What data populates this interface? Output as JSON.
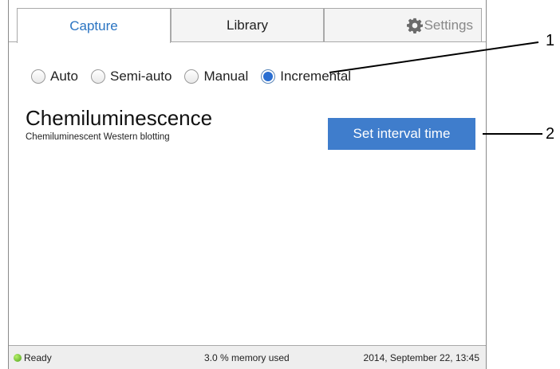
{
  "tabs": [
    {
      "label": "Capture"
    },
    {
      "label": "Library"
    },
    {
      "label": "Settings",
      "icon": "gear-icon"
    }
  ],
  "capture_modes": {
    "options": [
      "Auto",
      "Semi-auto",
      "Manual",
      "Incremental"
    ],
    "selected": "Incremental"
  },
  "application": {
    "title": "Chemiluminescence",
    "subtitle": "Chemiluminescent Western blotting"
  },
  "interval_button": {
    "label": "Set interval time"
  },
  "status_bar": {
    "state": "Ready",
    "memory": "3.0 % memory used",
    "datetime": "2014, September 22, 13:45"
  },
  "callouts": [
    "1",
    "2"
  ],
  "colors": {
    "accent": "#2a74c2",
    "button": "#3f7dcc",
    "radio_selected": "#2a6ed1",
    "status_led": "#4fa21c"
  }
}
